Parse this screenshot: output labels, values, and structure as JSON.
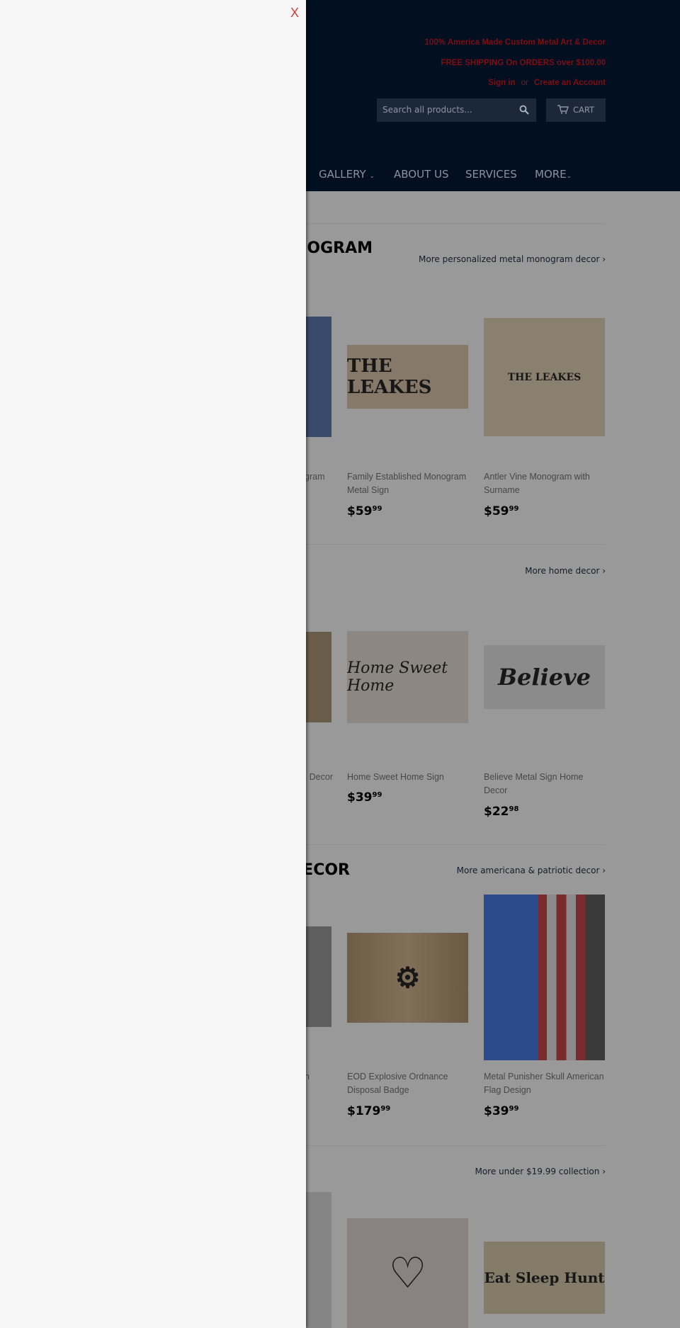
{
  "drawer": {
    "close_label": "X"
  },
  "header": {
    "tagline": "100% America Made Custom Metal Art & Decor",
    "shipping": "FREE SHIPPING On ORDERS over $100.00",
    "sign_in": "Sign in",
    "or": "or",
    "create_account": "Create an Account",
    "search_placeholder": "Search all products...",
    "cart_label": "CART"
  },
  "nav": [
    {
      "label": "GALLERY",
      "icon": "chevron-down-icon"
    },
    {
      "label": "ABOUT US"
    },
    {
      "label": "SERVICES"
    },
    {
      "label": "MORE",
      "icon": "chevron-down-icon"
    }
  ],
  "sections": [
    {
      "heading": "NOGRAM",
      "more": "More personalized metal monogram decor ›",
      "products": [
        {
          "title": "gram",
          "price": "",
          "cents": ""
        },
        {
          "title": "Family Established Monogram Metal Sign",
          "price": "$59",
          "cents": "99",
          "sign": "THE LEAKES"
        },
        {
          "title": "Antler Vine Monogram with Surname",
          "price": "$59",
          "cents": "99",
          "sign": "THE LEAKES"
        }
      ]
    },
    {
      "heading": "",
      "more": "More home decor ›",
      "products": [
        {
          "title": "Decor",
          "price": "",
          "cents": ""
        },
        {
          "title": "Home Sweet Home Sign",
          "price": "$39",
          "cents": "99",
          "sign": "Home Sweet Home"
        },
        {
          "title": "Believe Metal Sign Home Decor",
          "price": "$22",
          "cents": "98",
          "sign": "Believe"
        }
      ]
    },
    {
      "heading": "ECOR",
      "more": "More americana & patriotic decor ›",
      "products": [
        {
          "title": "n",
          "price": "",
          "cents": ""
        },
        {
          "title": "EOD Explosive Ordnance Disposal Badge",
          "price": "$179",
          "cents": "99"
        },
        {
          "title": "Metal Punisher Skull American Flag Design",
          "price": "$39",
          "cents": "99"
        }
      ]
    },
    {
      "heading": "",
      "more": "More under $19.99 collection ›",
      "products": [
        {
          "title": ""
        },
        {
          "title": ""
        },
        {
          "title": "",
          "sign": "Eat Sleep Hunt"
        }
      ]
    }
  ],
  "colors": {
    "header_bg": "#020f21",
    "tagline": "#7d0e12",
    "close": "#d83a3a"
  }
}
